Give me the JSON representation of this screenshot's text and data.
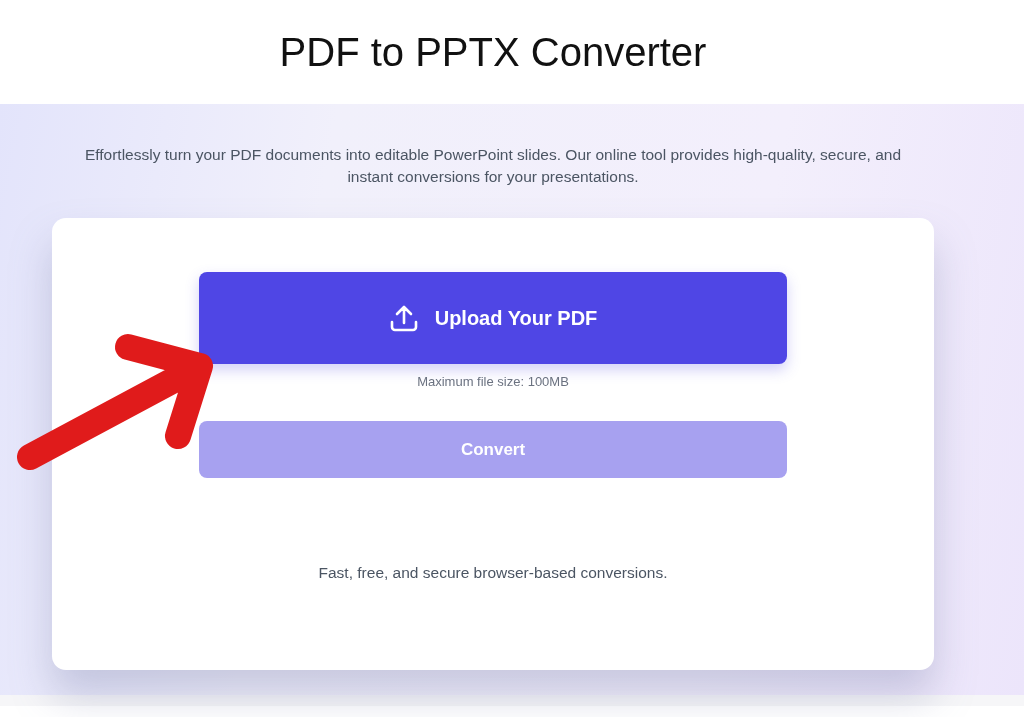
{
  "page": {
    "title": "PDF to PPTX Converter",
    "description": "Effortlessly turn your PDF documents into editable PowerPoint slides. Our online tool provides high-quality, secure, and instant conversions for your presentations."
  },
  "card": {
    "upload_button": "Upload Your PDF",
    "size_hint": "Maximum file size: 100MB",
    "convert_button": {
      "label": "Convert",
      "disabled": true
    },
    "footer_note": "Fast, free, and secure browser-based conversions."
  }
}
